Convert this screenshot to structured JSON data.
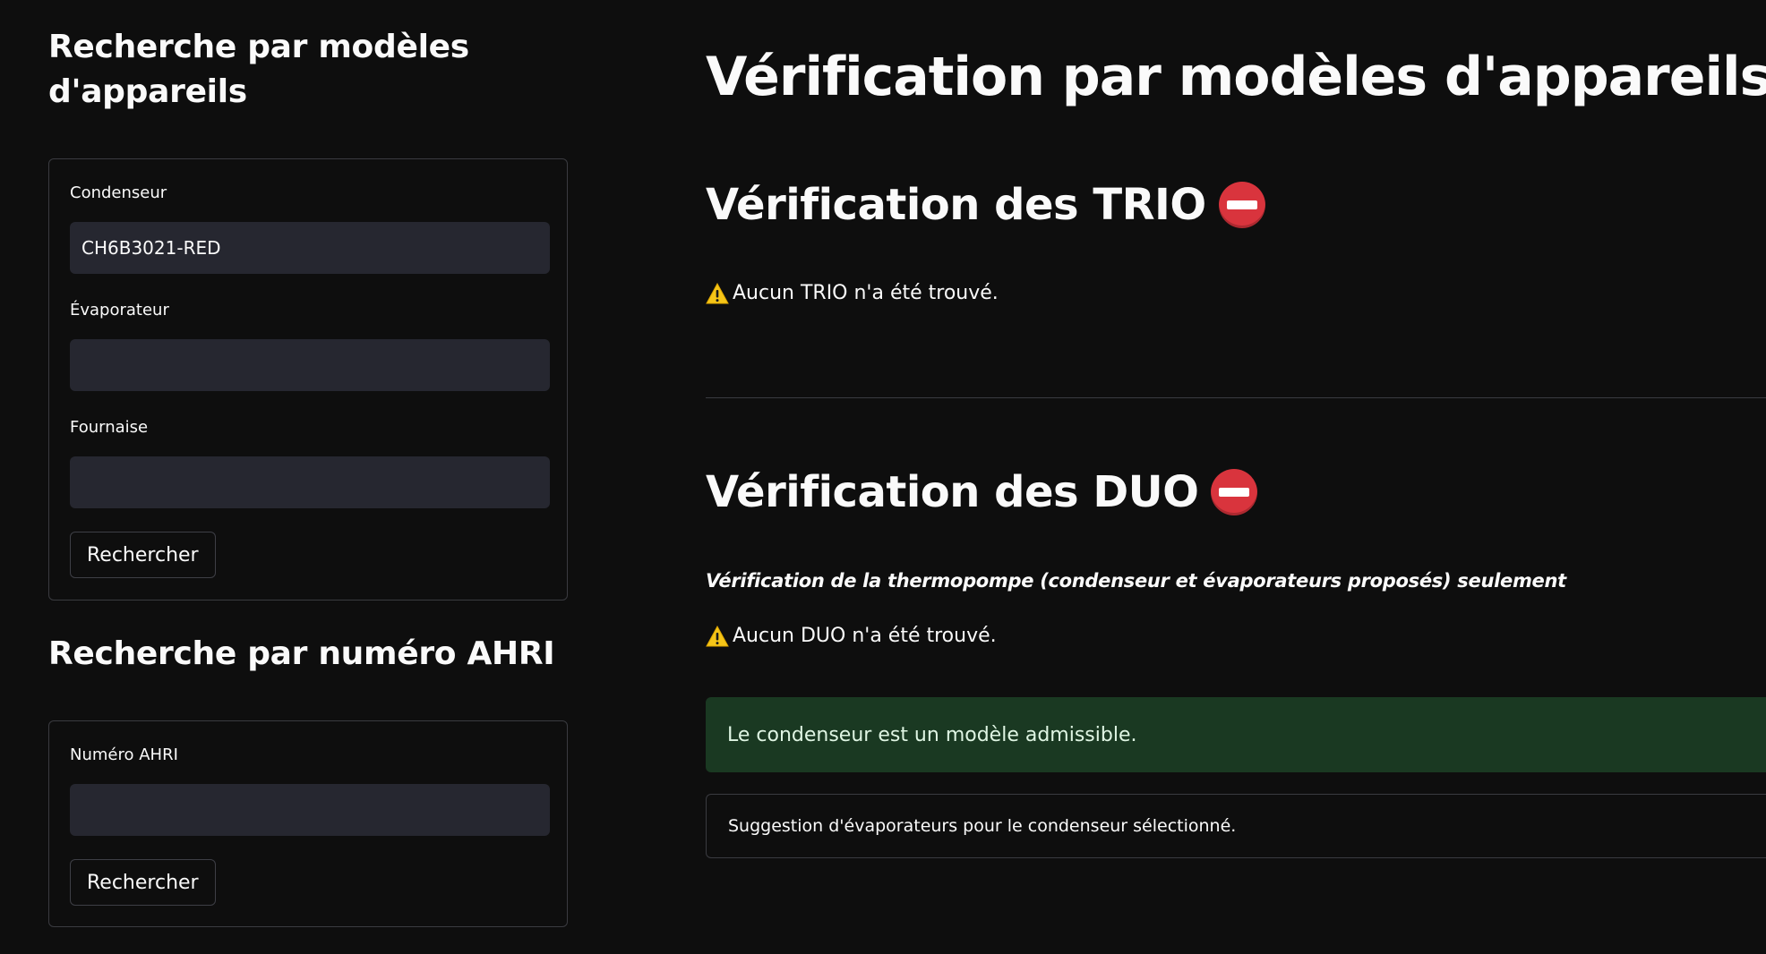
{
  "sidebar": {
    "model_search_title": "Recherche par modèles d'appareils",
    "model_form": {
      "condenser_label": "Condenseur",
      "condenser_value": "CH6B3021-RED",
      "evaporator_label": "Évaporateur",
      "evaporator_value": "",
      "furnace_label": "Fournaise",
      "furnace_value": "",
      "search_button": "Rechercher"
    },
    "ahri_search_title": "Recherche par numéro AHRI",
    "ahri_form": {
      "ahri_label": "Numéro AHRI",
      "ahri_value": "",
      "search_button": "Rechercher"
    }
  },
  "main": {
    "title": "Vérification par modèles d'appareils",
    "trio": {
      "title": "Vérification des TRIO",
      "status_icon": "no-entry-icon",
      "warning": "Aucun TRIO n'a été trouvé."
    },
    "duo": {
      "title": "Vérification des DUO",
      "status_icon": "no-entry-icon",
      "caption": "Vérification de la thermopompe (condenseur et évaporateurs proposés) seulement",
      "warning": "Aucun DUO n'a été trouvé."
    },
    "success_message": "Le condenseur est un modèle admissible.",
    "suggestion_expander": "Suggestion d'évaporateurs pour le condenseur sélectionné."
  },
  "colors": {
    "background": "#0e0e0e",
    "input_background": "#262730",
    "success_background": "#1a3922",
    "no_entry_red": "#d9343d",
    "warning_yellow": "#f5c518"
  }
}
